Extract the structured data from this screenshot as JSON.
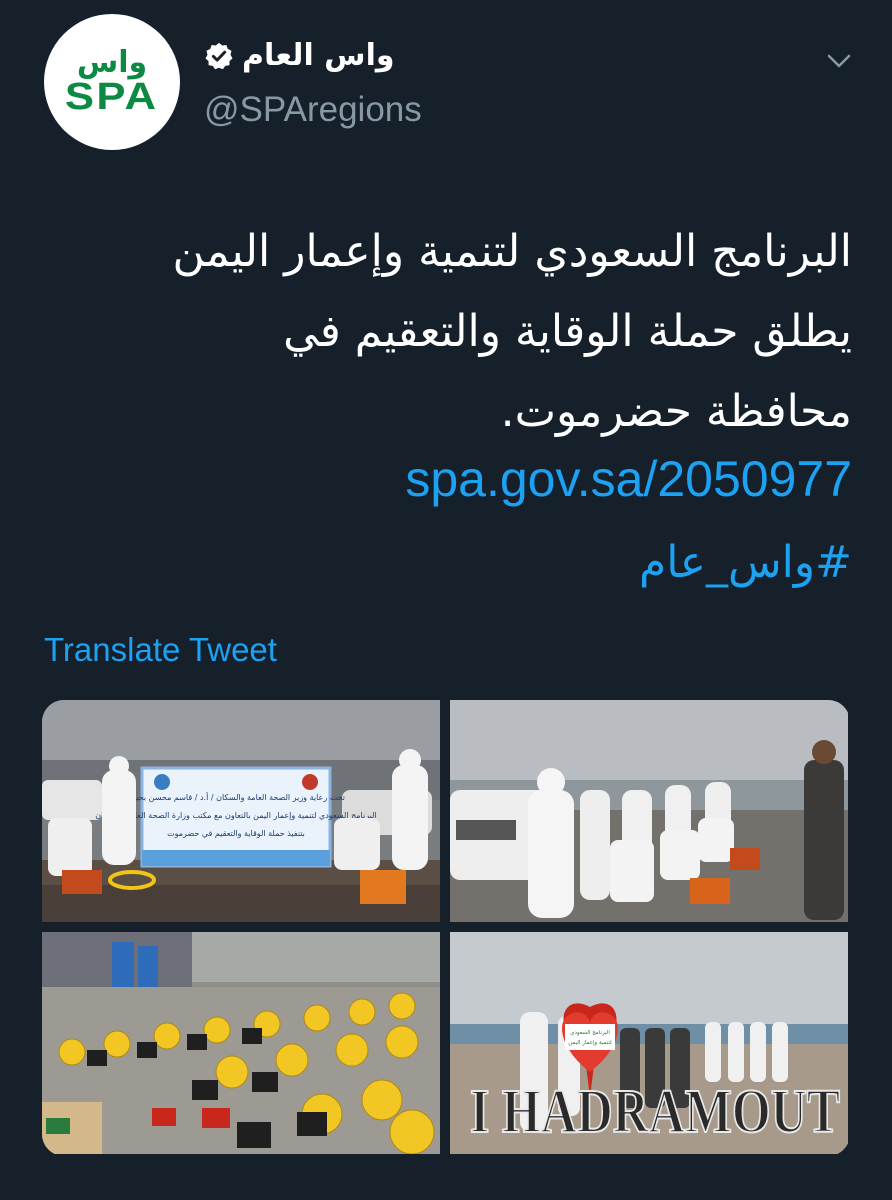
{
  "account": {
    "display_name": "واس العام",
    "handle": "@SPAregions",
    "verified": true,
    "avatar": {
      "logo_top": "واس",
      "logo_bottom": "SPA",
      "brand_color": "#0c8a43"
    }
  },
  "tweet": {
    "lines": [
      "البرنامج السعودي لتنمية وإعمار اليمن",
      "يطلق حملة الوقاية والتعقيم في",
      "محافظة حضرموت."
    ],
    "link": "spa.gov.sa/2050977",
    "hashtag": "#واس_عام",
    "translate_label": "Translate Tweet"
  },
  "banner": {
    "lines": [
      "تحت رعاية وزير الصحة العامة والسكان / أ.د / قاسم محسن بحيوح",
      "البرنامج السعودي لتنمية وإعمار اليمن بالتعاون مع مكتب وزارة الصحة العامة والسكان",
      "بتنفيذ حملة الوقاية والتعقيم في حضرموت"
    ]
  },
  "sign": {
    "text": "I HADRAMOUT",
    "heart_lines": [
      "البرنامج السعودي",
      "لتنمية وإعمار اليمن"
    ]
  },
  "icons": {
    "verified": "verified-badge-icon",
    "chevron": "chevron-down-icon"
  },
  "colors": {
    "background": "#15202b",
    "text": "#ffffff",
    "secondary_text": "#8899a6",
    "link": "#1da1f2"
  }
}
